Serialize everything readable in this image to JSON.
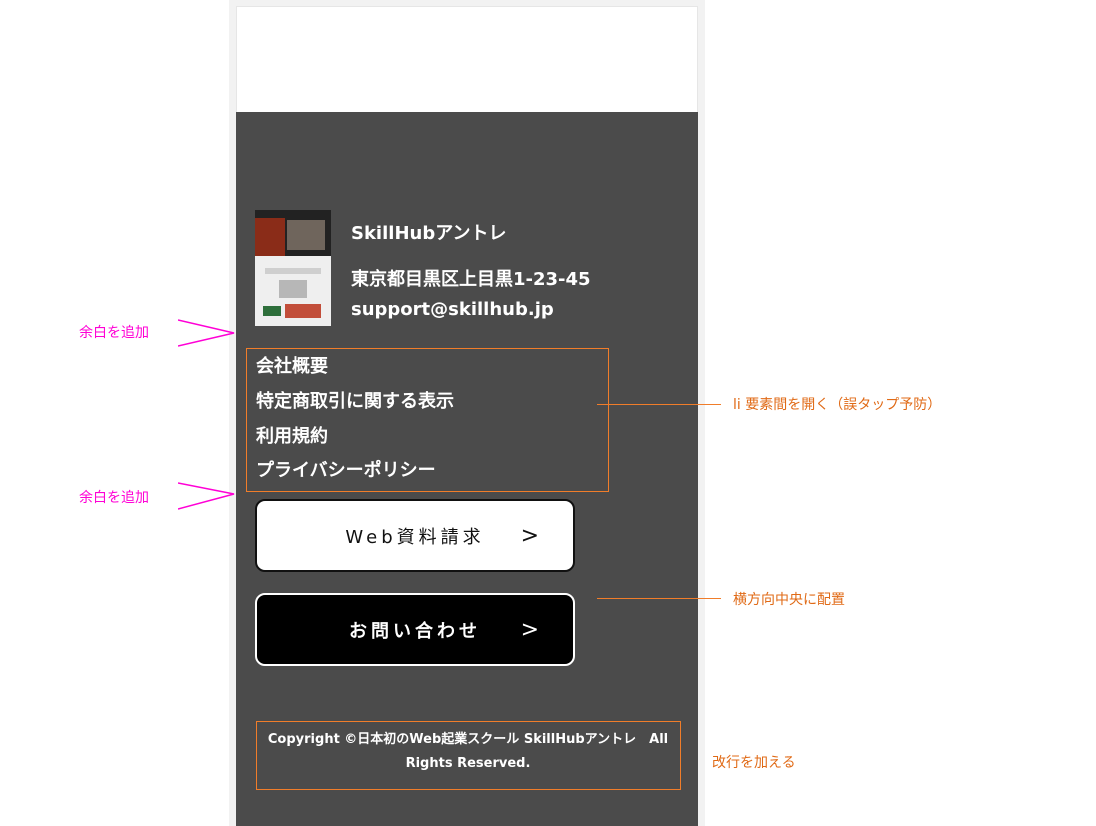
{
  "company": {
    "name": "SkillHubアントレ",
    "address": "東京都目黒区上目黒1-23-45",
    "email": "support@skillhub.jp"
  },
  "nav": [
    "会社概要",
    "特定商取引に関する表示",
    "利用規約",
    "プライバシーポリシー"
  ],
  "buttons": {
    "materials": {
      "label": "Web資料請求",
      "chevron": ">"
    },
    "contact": {
      "label": "お問い合わせ",
      "chevron": ">"
    }
  },
  "copyright": {
    "line1": "Copyright ©日本初のWeb起業スクール SkillHubアントレ　All",
    "line2": "Rights Reserved."
  },
  "annotations": {
    "margin_top": "余白を追加",
    "margin_bottom": "余白を追加",
    "li_spacing": "li 要素間を開く（誤タップ予防）",
    "center": "横方向中央に配置",
    "line_break": "改行を加える"
  },
  "colors": {
    "footer_bg": "#4b4b4b",
    "annotation_pink": "#ff00d6",
    "annotation_orange": "#e06a16",
    "contact_button_bg": "#000000"
  }
}
